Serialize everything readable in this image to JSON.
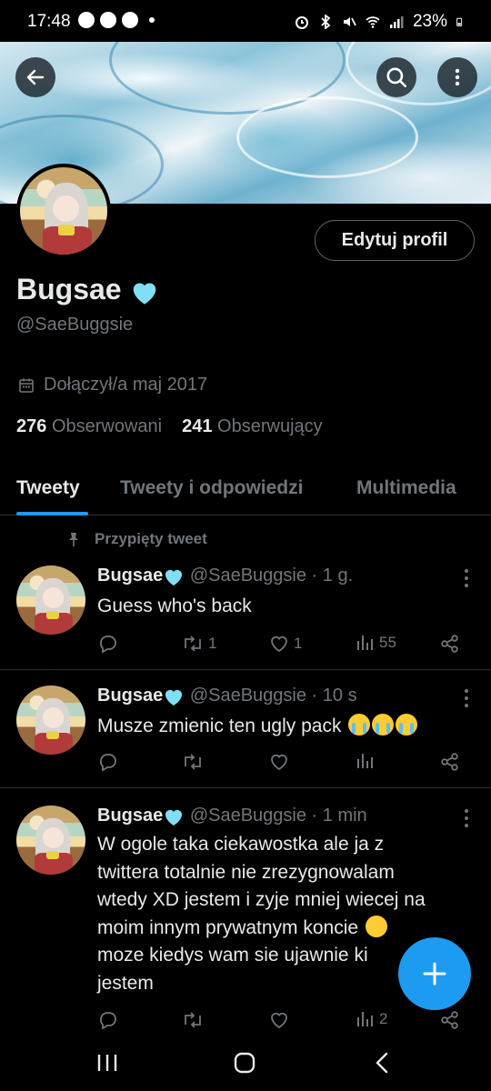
{
  "status_bar": {
    "time": "17:48",
    "battery": "23%"
  },
  "profile": {
    "display_name": "Bugsae",
    "name_emoji": "light-blue-heart",
    "handle": "@SaeBuggsie",
    "joined": "Dołączył/a maj 2017",
    "following_count": "276",
    "following_label": "Obserwowani",
    "followers_count": "241",
    "followers_label": "Obserwujący",
    "edit_button": "Edytuj profil"
  },
  "tabs": [
    {
      "label": "Tweety",
      "active": true
    },
    {
      "label": "Tweety i odpowiedzi",
      "active": false
    },
    {
      "label": "Multimedia",
      "active": false
    }
  ],
  "pinned_label": "Przypięty tweet",
  "tweets": [
    {
      "name": "Bugsae",
      "handle": "@SaeBuggsie",
      "time": "· 1 g.",
      "text": "Guess who's back",
      "replies": "",
      "retweets": "1",
      "likes": "1",
      "views": "55"
    },
    {
      "name": "Bugsae",
      "handle": "@SaeBuggsie",
      "time": "· 10 s",
      "text": "Musze zmienic ten ugly pack",
      "emojis": [
        "loudly-crying-face",
        "loudly-crying-face",
        "loudly-crying-face"
      ],
      "replies": "",
      "retweets": "",
      "likes": "",
      "views": ""
    },
    {
      "name": "Bugsae",
      "handle": "@SaeBuggsie",
      "time": "· 1 min",
      "lines": [
        "W ogole taka ciekawostka ale ja z",
        "twittera totalnie nie zrezygnowalam",
        "wtedy XD jestem i zyje mniej wiecej na",
        "moim innym prywatnym koncie",
        "moze kiedys wam sie ujawnie ki",
        "jestem"
      ],
      "emojis": [
        "shushing-face"
      ],
      "replies": "",
      "retweets": "",
      "likes": "",
      "views": "2"
    }
  ],
  "colors": {
    "accent": "#1d9bf0",
    "heart": "#7fe0f5",
    "secondary_text": "#71767b"
  }
}
